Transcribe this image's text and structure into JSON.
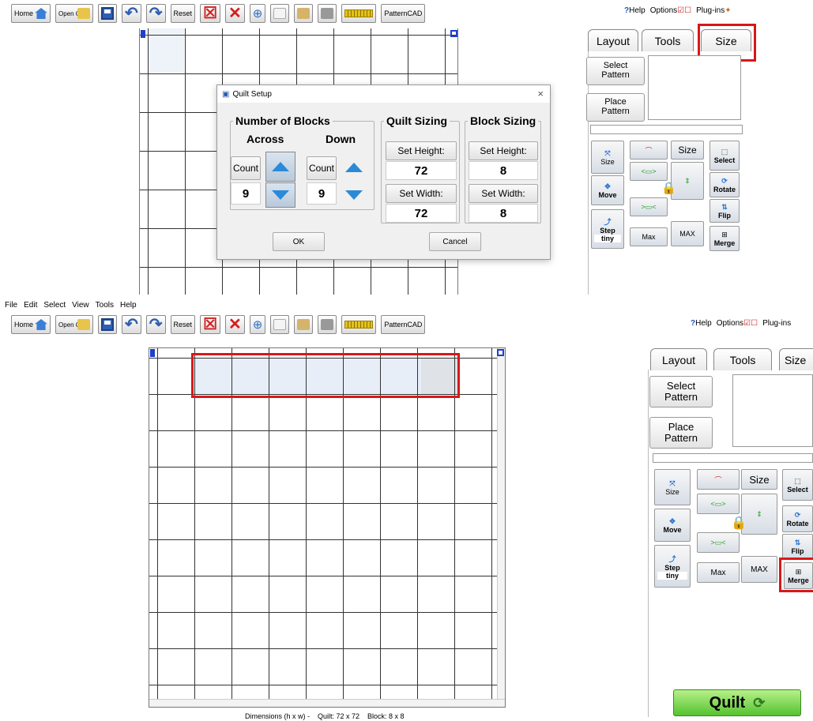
{
  "toolbar": {
    "home": "Home",
    "open_quilt": "Open Quilt",
    "reset": "Reset",
    "patterncad": "PatternCAD",
    "help": "Help",
    "help_prefix": "?",
    "options": "Options",
    "plugins": "Plug-ins"
  },
  "menu": [
    "File",
    "Edit",
    "Select",
    "View",
    "Tools",
    "Help"
  ],
  "panel": {
    "tabs": [
      "Layout",
      "Tools",
      "Size"
    ],
    "select_pattern": [
      "Select",
      "Pattern"
    ],
    "place_pattern": [
      "Place",
      "Pattern"
    ],
    "tools": {
      "size_icon": "Size",
      "size_label": "Size",
      "select": "Select",
      "move": "Move",
      "rotate": "Rotate",
      "flip": "Flip",
      "step": "Step",
      "step_value": "tiny",
      "max_left": "Max",
      "max_right": "MAX",
      "merge": "Merge"
    }
  },
  "dialog": {
    "title": "Quilt Setup",
    "close": "×",
    "number_of_blocks": "Number of Blocks",
    "across": "Across",
    "down": "Down",
    "count": "Count",
    "across_value": "9",
    "down_value": "9",
    "quilt_sizing": "Quilt Sizing",
    "block_sizing": "Block Sizing",
    "set_height": "Set Height:",
    "set_width": "Set Width:",
    "quilt_height": "72",
    "quilt_width": "72",
    "block_height": "8",
    "block_width": "8",
    "ok": "OK",
    "cancel": "Cancel"
  },
  "status": {
    "dimensions": "Dimensions (h x w) -",
    "quilt": "Quilt: 72 x 72",
    "block": "Block: 8 x 8"
  },
  "quilt_button": "Quilt",
  "colors": {
    "highlight": "#d81818",
    "row_fill": "#e8eef8",
    "selected_cell": "#dfe2e6"
  }
}
